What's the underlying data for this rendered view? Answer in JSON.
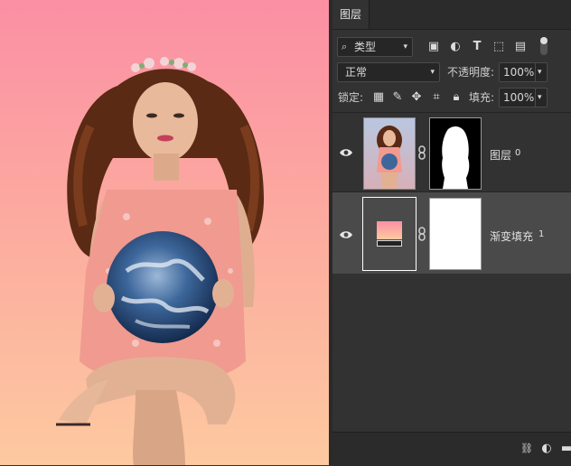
{
  "panel": {
    "tab_label": "图层",
    "filter": {
      "label": "类型"
    },
    "blend_mode": "正常",
    "opacity_label": "不透明度:",
    "opacity_value": "100%",
    "lock_label": "锁定:",
    "fill_label": "填充:",
    "fill_value": "100%",
    "layers": [
      {
        "name": "图层",
        "index": "0"
      },
      {
        "name": "渐变填充",
        "index": "1"
      }
    ]
  },
  "colors": {
    "canvas_top": "#fb8fa4",
    "canvas_bottom": "#fdc9a0",
    "panel_bg": "#323232",
    "selected_layer_bg": "#4a4a4a"
  }
}
